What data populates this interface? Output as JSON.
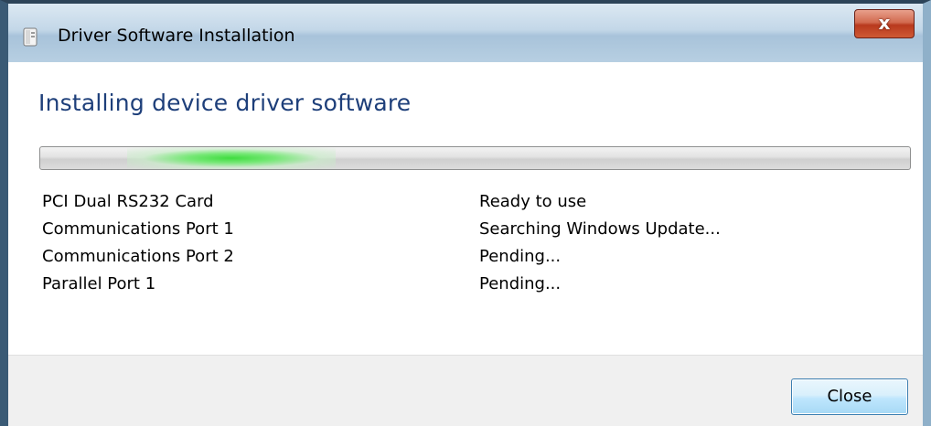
{
  "window": {
    "title": "Driver Software Installation",
    "close_glyph": "x",
    "icon": "driver-install-icon"
  },
  "main": {
    "heading": "Installing device driver software",
    "progress": {
      "mode": "indeterminate-marquee",
      "glow_position_fraction": 0.22,
      "color": "#3fdc3f"
    },
    "devices": [
      {
        "name": "PCI Dual RS232 Card",
        "status": "Ready to use"
      },
      {
        "name": "Communications Port 1",
        "status": "Searching Windows Update..."
      },
      {
        "name": "Communications Port 2",
        "status": "Pending..."
      },
      {
        "name": "Parallel Port 1",
        "status": "Pending..."
      }
    ]
  },
  "footer": {
    "close_label": "Close"
  },
  "colors": {
    "heading": "#1e3f7a",
    "close_x_red": "#b8391d",
    "button_blue": "#bee6fd"
  }
}
